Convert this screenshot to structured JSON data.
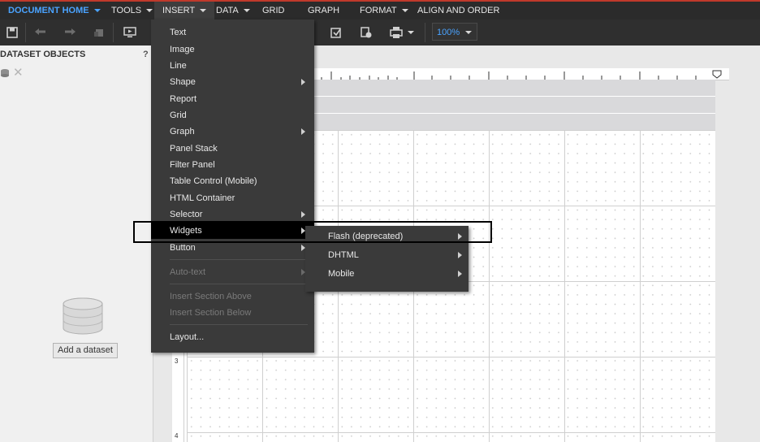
{
  "menubar": {
    "items": [
      {
        "label": "DOCUMENT HOME"
      },
      {
        "label": "TOOLS"
      },
      {
        "label": "INSERT"
      },
      {
        "label": "DATA"
      },
      {
        "label": "GRID"
      },
      {
        "label": "GRAPH"
      },
      {
        "label": "FORMAT"
      },
      {
        "label": "ALIGN AND ORDER"
      }
    ]
  },
  "toolbar": {
    "zoom": "100%",
    "icons": [
      "save-icon",
      "undo-icon",
      "redo-icon",
      "clear-icon",
      "presentation-icon",
      "dataset-edit-icon",
      "dataset-settings-icon",
      "print-icon"
    ]
  },
  "left_panel": {
    "title": "DATASET OBJECTS",
    "help": "?",
    "add_dataset": "Add a dataset"
  },
  "insert_menu": {
    "items": [
      {
        "label": "Text"
      },
      {
        "label": "Image"
      },
      {
        "label": "Line"
      },
      {
        "label": "Shape"
      },
      {
        "label": "Report"
      },
      {
        "label": "Grid"
      },
      {
        "label": "Graph"
      },
      {
        "label": "Panel Stack"
      },
      {
        "label": "Filter Panel"
      },
      {
        "label": "Table Control (Mobile)"
      },
      {
        "label": "HTML Container"
      },
      {
        "label": "Selector"
      },
      {
        "label": "Widgets"
      },
      {
        "label": "Button"
      },
      {
        "label": "Auto-text"
      },
      {
        "label": "Insert Section Above"
      },
      {
        "label": "Insert Section Below"
      },
      {
        "label": "Layout..."
      }
    ]
  },
  "widgets_submenu": {
    "items": [
      {
        "label": "Flash (deprecated)"
      },
      {
        "label": "DHTML"
      },
      {
        "label": "Mobile"
      }
    ]
  },
  "canvas": {
    "section_labels": [
      "3",
      "4"
    ]
  }
}
